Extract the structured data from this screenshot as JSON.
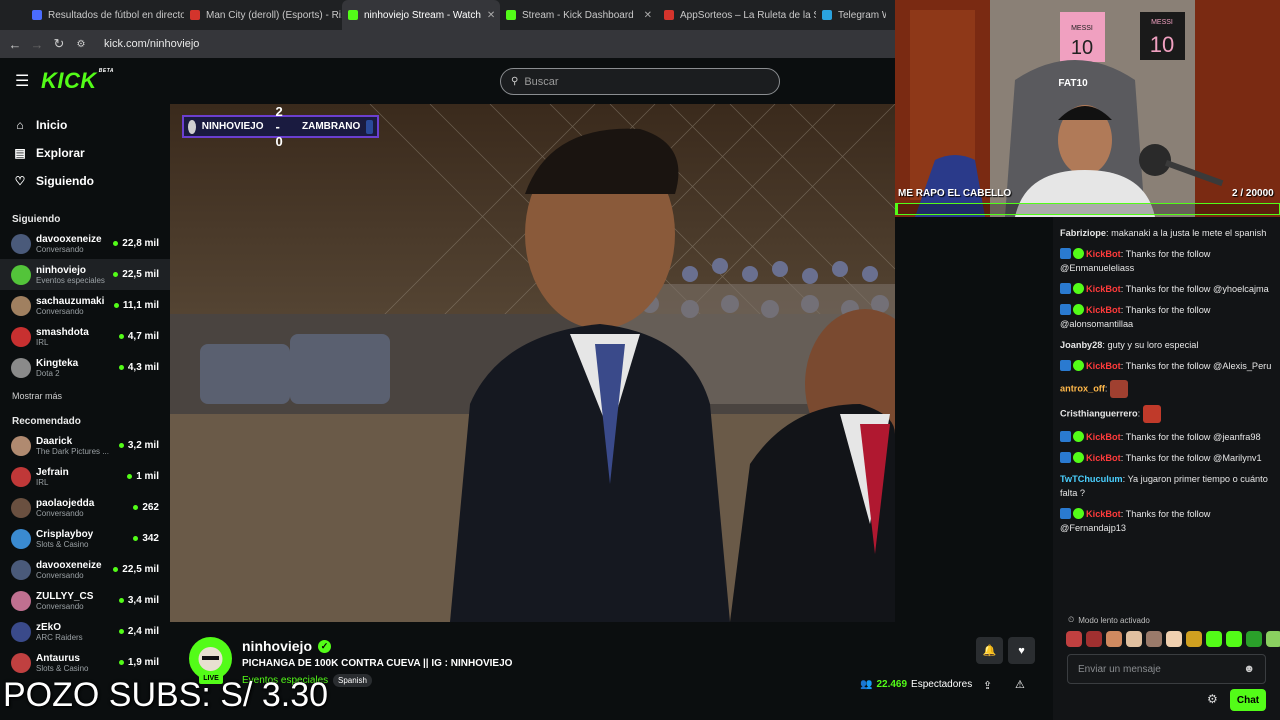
{
  "browser": {
    "tabs": [
      {
        "title": "Resultados de fútbol en directo",
        "color": "#4a6cff"
      },
      {
        "title": "Man City (deroll) (Esports) - Ri...",
        "color": "#d4342c"
      },
      {
        "title": "ninhoviejo Stream - Watch",
        "color": "#53fc18"
      },
      {
        "title": "Stream - Kick Dashboard",
        "color": "#53fc18"
      },
      {
        "title": "AppSorteos – La Ruleta de la S...",
        "color": "#d4342c"
      },
      {
        "title": "Telegram Web",
        "color": "#2aa3e0"
      }
    ],
    "url": "kick.com/ninhoviejo"
  },
  "header": {
    "logo": "KICK",
    "logo_badge": "BETA",
    "search_placeholder": "Buscar"
  },
  "sidebar": {
    "nav": [
      {
        "label": "Inicio",
        "icon": "home-icon",
        "glyph": "⌂"
      },
      {
        "label": "Explorar",
        "icon": "compass-icon",
        "glyph": "▤"
      },
      {
        "label": "Siguiendo",
        "icon": "heart-icon",
        "glyph": "♡"
      }
    ],
    "following_title": "Siguiendo",
    "following": [
      {
        "name": "davooxeneize",
        "category": "Conversando",
        "viewers": "22,8 mil",
        "color": "#4a5a7a"
      },
      {
        "name": "ninhoviejo",
        "category": "Eventos especiales",
        "viewers": "22,5 mil",
        "color": "#53c43a"
      },
      {
        "name": "sachauzumaki",
        "category": "Conversando",
        "viewers": "11,1 mil",
        "color": "#a08060"
      },
      {
        "name": "smashdota",
        "category": "IRL",
        "viewers": "4,7 mil",
        "color": "#c83030"
      },
      {
        "name": "Kingteka",
        "category": "Dota 2",
        "viewers": "4,3 mil",
        "color": "#8a8a8a"
      }
    ],
    "show_more": "Mostrar más",
    "recommended_title": "Recomendado",
    "recommended": [
      {
        "name": "Daarick",
        "category": "The Dark Pictures ...",
        "viewers": "3,2 mil",
        "color": "#b08a70"
      },
      {
        "name": "Jefrain",
        "category": "IRL",
        "viewers": "1 mil",
        "color": "#c03838"
      },
      {
        "name": "paolaojedda",
        "category": "Conversando",
        "viewers": "262",
        "color": "#6a5040"
      },
      {
        "name": "Crisplayboy",
        "category": "Slots & Casino",
        "viewers": "342",
        "color": "#3a8ad0"
      },
      {
        "name": "davooxeneize",
        "category": "Conversando",
        "viewers": "22,5 mil",
        "color": "#4a5a7a"
      },
      {
        "name": "ZULLYY_CS",
        "category": "Conversando",
        "viewers": "3,4 mil",
        "color": "#c07090"
      },
      {
        "name": "zEkO",
        "category": "ARC Raiders",
        "viewers": "2,4 mil",
        "color": "#3a4a8a"
      },
      {
        "name": "Antaurus",
        "category": "Slots & Casino",
        "viewers": "1,9 mil",
        "color": "#c04040"
      }
    ]
  },
  "video": {
    "score_home": "NINHOVIEJO",
    "score": "2 - 0",
    "score_away": "ZAMBRANO"
  },
  "stream": {
    "name": "ninhoviejo",
    "live": "LIVE",
    "title": "PICHANGA DE 100K CONTRA CUEVA || IG : NINHOVIEJO",
    "category": "Eventos especiales",
    "language": "Spanish",
    "viewers": "22.469",
    "viewers_label": "Espectadores"
  },
  "overlay": {
    "pozo": "POZO SUBS: S/ 3.30"
  },
  "webcam": {
    "goal_label": "ME RAPO EL CABELLO",
    "goal_count": "2 / 20000",
    "goal_fraction": 0.0001,
    "jersey_left": "MESSI 10",
    "jersey_right": "MESSI 10",
    "chair_text": "FAT10"
  },
  "chat": {
    "messages": [
      {
        "user": "Fabriziope",
        "color": "#e6e6e6",
        "text": "makanaki a la justa le mete el spanish",
        "badges": false
      },
      {
        "user": "KickBot",
        "color": "#ff3b3b",
        "text": "Thanks for the follow @Enmanueleliass",
        "badges": true
      },
      {
        "user": "KickBot",
        "color": "#ff3b3b",
        "text": "Thanks for the follow @yhoelcajma",
        "badges": true
      },
      {
        "user": "KickBot",
        "color": "#ff3b3b",
        "text": "Thanks for the follow @alonsomantillaa",
        "badges": true
      },
      {
        "user": "Joanby28",
        "color": "#e6e6e6",
        "text": "guty y su loro especial",
        "badges": false
      },
      {
        "user": "KickBot",
        "color": "#ff3b3b",
        "text": "Thanks for the follow @Alexis_Peru",
        "badges": true
      },
      {
        "user": "antrox_off",
        "color": "#ffb84a",
        "text": "",
        "badges": false,
        "emote": "#a04030"
      },
      {
        "user": "Cristhianguerrero",
        "color": "#e6e6e6",
        "text": "",
        "badges": false,
        "emote": "#c03a2a"
      },
      {
        "user": "KickBot",
        "color": "#ff3b3b",
        "text": "Thanks for the follow @jeanfra98",
        "badges": true
      },
      {
        "user": "KickBot",
        "color": "#ff3b3b",
        "text": "Thanks for the follow @Marilynv1",
        "badges": true
      },
      {
        "user": "TwTChuculum",
        "color": "#4ad0ff",
        "text": "Ya jugaron primer tiempo o cuánto falta ?",
        "badges": false
      },
      {
        "user": "KickBot",
        "color": "#ff3b3b",
        "text": "Thanks for the follow @Fernandajp13",
        "badges": true
      }
    ],
    "slow_mode": "Modo lento activado",
    "input_placeholder": "Enviar un mensaje",
    "send_label": "Chat"
  }
}
